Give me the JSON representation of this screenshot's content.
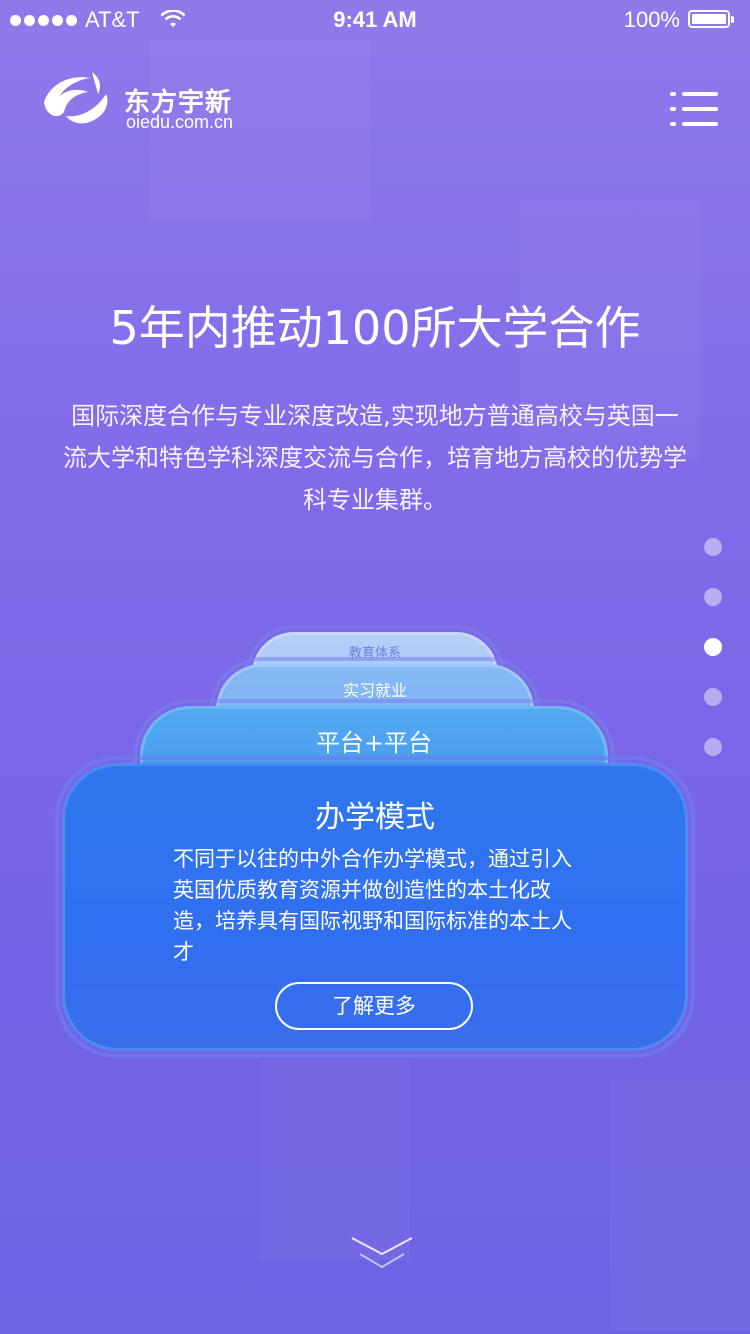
{
  "status_bar": {
    "carrier": "AT&T",
    "time": "9:41 AM",
    "battery_percent": "100%",
    "battery_level": 1.0,
    "signal_bars": 5,
    "wifi_icon": "wifi-icon",
    "battery_icon": "battery-icon"
  },
  "header": {
    "logo_cn": "东方宇新",
    "logo_en": "oiedu.com.cn",
    "menu_icon": "hamburger-menu-icon"
  },
  "hero": {
    "headline": "5年内推动100所大学合作",
    "description": "国际深度合作与专业深度改造,实现地方普通高校与英国一流大学和特色学科深度交流与合作，培育地方高校的优势学科专业集群。"
  },
  "pager": {
    "total": 5,
    "active_index": 2
  },
  "stack": {
    "tiers": [
      {
        "label": "教育体系"
      },
      {
        "label": "实习就业"
      },
      {
        "label": "平台+平台"
      }
    ],
    "main_card": {
      "title": "办学模式",
      "text": "不同于以往的中外合作办学模式，通过引入英国优质教育资源并做创造性的本土化改造，培养具有国际视野和国际标准的本土人才",
      "button_label": "了解更多"
    }
  },
  "scroll_hint": {
    "icon": "double-chevron-down-icon"
  },
  "colors": {
    "background_top": "#8f79ea",
    "background_bottom": "#6d63e3",
    "card_primary": "#2f77ee",
    "tier_2": "#52a8f0",
    "tier_3": "#87b9f5",
    "tier_4": "#b6cff8"
  }
}
